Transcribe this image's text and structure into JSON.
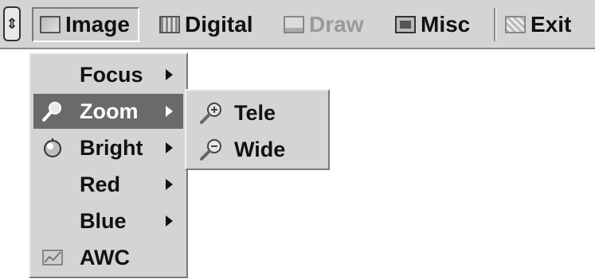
{
  "menubar": {
    "items": [
      {
        "label": "Image",
        "icon": "image-icon",
        "state": "selected"
      },
      {
        "label": "Digital",
        "icon": "digital-icon",
        "state": "normal"
      },
      {
        "label": "Draw",
        "icon": "draw-icon",
        "state": "disabled"
      },
      {
        "label": "Misc",
        "icon": "misc-icon",
        "state": "normal"
      },
      {
        "label": "Exit",
        "icon": "exit-icon",
        "state": "normal"
      }
    ]
  },
  "dropdown": {
    "items": [
      {
        "label": "Focus",
        "icon": null,
        "has_submenu": true
      },
      {
        "label": "Zoom",
        "icon": "magnifier-icon",
        "has_submenu": true,
        "active": true
      },
      {
        "label": "Bright",
        "icon": "bright-icon",
        "has_submenu": true
      },
      {
        "label": "Red",
        "icon": null,
        "has_submenu": true
      },
      {
        "label": "Blue",
        "icon": null,
        "has_submenu": true
      },
      {
        "label": "AWC",
        "icon": "awc-icon",
        "has_submenu": false
      }
    ]
  },
  "submenu": {
    "items": [
      {
        "label": "Tele",
        "icon": "zoom-in-icon"
      },
      {
        "label": "Wide",
        "icon": "zoom-out-icon"
      }
    ]
  },
  "colors": {
    "menu_bg": "#d4d4d4",
    "active_bg": "#6a6a6a",
    "active_text": "#ffffff",
    "disabled_text": "#9a9a9a"
  }
}
